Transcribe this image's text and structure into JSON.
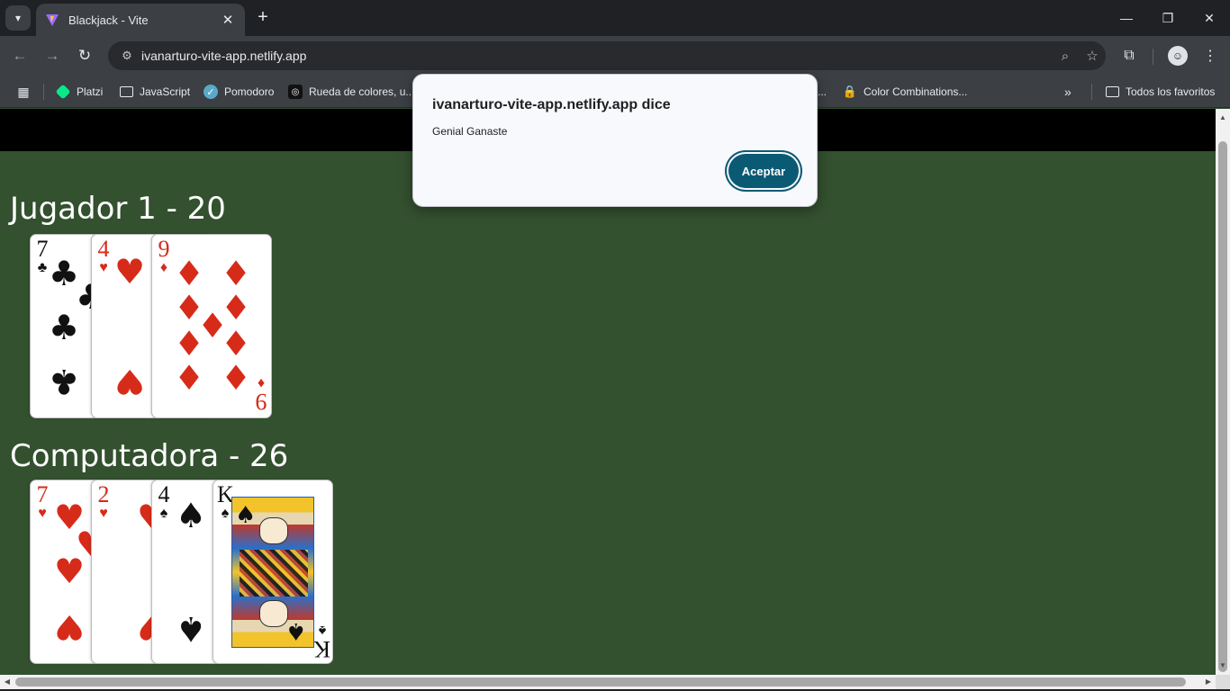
{
  "browser": {
    "tab_title": "Blackjack - Vite",
    "url": "ivanarturo-vite-app.netlify.app",
    "bookmarks": [
      {
        "label": "Platzi",
        "icon": "platzi-icon"
      },
      {
        "label": "JavaScript",
        "icon": "folder-icon"
      },
      {
        "label": "Pomodoro",
        "icon": "check-circle-icon"
      },
      {
        "label": "Rueda de colores, u...",
        "icon": "color-wheel-icon"
      },
      {
        "label": "...",
        "icon": ""
      },
      {
        "label": "Color Combinations...",
        "icon": "lock-icon"
      }
    ],
    "all_bookmarks_label": "Todos los favoritos"
  },
  "game": {
    "player_heading": "Jugador 1 - 20",
    "computer_heading": "Computadora - 26",
    "player_cards": [
      {
        "rank": "7",
        "suit": "♣",
        "color": "#111111"
      },
      {
        "rank": "4",
        "suit": "♥",
        "color": "#d72b1a"
      },
      {
        "rank": "9",
        "suit": "♦",
        "color": "#d72b1a"
      }
    ],
    "computer_cards": [
      {
        "rank": "7",
        "suit": "♥",
        "color": "#d72b1a"
      },
      {
        "rank": "2",
        "suit": "♥",
        "color": "#d72b1a"
      },
      {
        "rank": "4",
        "suit": "♠",
        "color": "#111111"
      },
      {
        "rank": "K",
        "suit": "♠",
        "color": "#111111"
      }
    ]
  },
  "dialog": {
    "title": "ivanarturo-vite-app.netlify.app dice",
    "message": "Genial Ganaste",
    "accept_label": "Aceptar"
  }
}
